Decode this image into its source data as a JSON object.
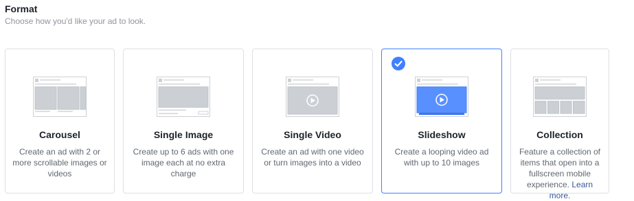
{
  "header": {
    "title": "Format",
    "subtitle": "Choose how you'd like your ad to look."
  },
  "formats": [
    {
      "title": "Carousel",
      "description": "Create an ad with 2 or more scrollable images or videos",
      "icon": "carousel-preview-icon",
      "selected": false
    },
    {
      "title": "Single Image",
      "description": "Create up to 6 ads with one image each at no extra charge",
      "icon": "single-image-preview-icon",
      "selected": false
    },
    {
      "title": "Single Video",
      "description": "Create an ad with one video or turn images into a video",
      "icon": "single-video-preview-icon",
      "selected": false
    },
    {
      "title": "Slideshow",
      "description": "Create a looping video ad with up to 10 images",
      "icon": "slideshow-preview-icon",
      "selected": true
    },
    {
      "title": "Collection",
      "description": "Feature a collection of items that open into a fullscreen mobile experience.",
      "link": "Learn more.",
      "icon": "collection-preview-icon",
      "selected": false
    }
  ],
  "colors": {
    "accent": "#4080ff",
    "card_border": "#dddfe2",
    "link": "#365899"
  }
}
